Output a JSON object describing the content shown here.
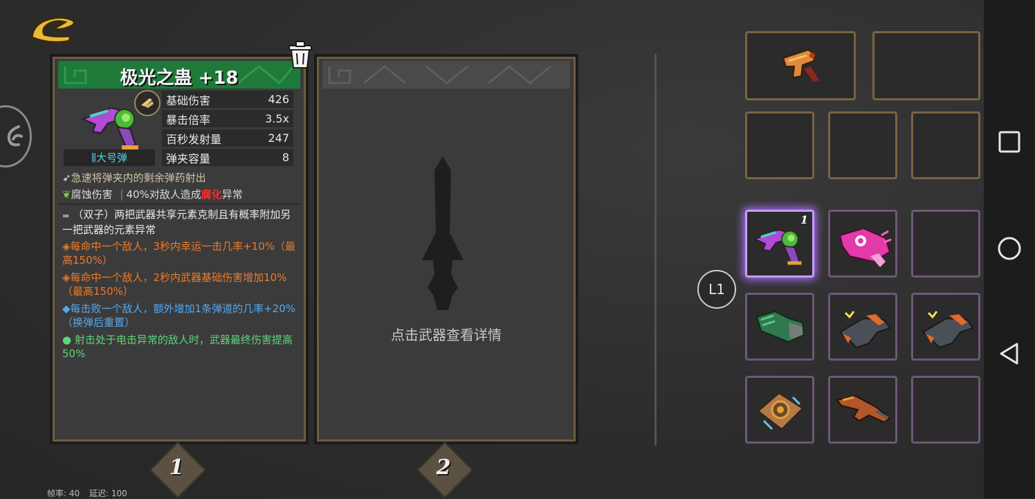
{
  "weapon": {
    "name": "极光之蛊 +18",
    "ammo_type": "大号弹",
    "stats": [
      {
        "label": "基础伤害",
        "value": "426"
      },
      {
        "label": "暴击倍率",
        "value": "3.5x"
      },
      {
        "label": "百秒发射量",
        "value": "247"
      },
      {
        "label": "弹夹容量",
        "value": "8"
      }
    ],
    "skill_line": "急速将弹夹内的剩余弹药射出",
    "element_name": "腐蚀伤害",
    "element_desc_prefix": "40%对敌人造成",
    "element_desc_highlight": "腐化",
    "element_desc_suffix": "异常",
    "passives": [
      {
        "text": "（双子）两把武器共享元素克制且有概率附加另一把武器的元素异常",
        "color": "#e8e8e8",
        "bullet": "▬"
      },
      {
        "text": "每命中一个敌人，3秒内幸运一击几率+10%（最高150%）",
        "color": "#f07a2a",
        "bullet": "◈"
      },
      {
        "text": "每命中一个敌人，2秒内武器基础伤害增加10%（最高150%）",
        "color": "#f07a2a",
        "bullet": "◈"
      },
      {
        "text": "每击败一个敌人，额外增加1条弹道的几率+20%（换弹后重置）",
        "color": "#55a8ee",
        "bullet": "◆"
      },
      {
        "text": "射击处于电击异常的敌人时，武器最终伤害提高50%",
        "color": "#5ed47a",
        "bullet": "●"
      }
    ]
  },
  "slot2": {
    "hint": "点击武器查看详情"
  },
  "slot_numbers": [
    "1",
    "2"
  ],
  "layer_button": "L1",
  "inventory": {
    "selected_badge": "1"
  },
  "footer": {
    "fps": "帧率: 40",
    "latency": "延迟: 100"
  },
  "colors": {
    "gold": "#7a6444",
    "purple": "#6e5878",
    "selected": "#c99cff",
    "header_green": "#1f7a3a",
    "corrosion_red": "#ff2a2a"
  },
  "icons": [
    "back-icon",
    "trash-icon",
    "side-menu-icon",
    "nav-square-icon",
    "nav-circle-icon",
    "nav-back-icon",
    "sword-silhouette-icon"
  ]
}
